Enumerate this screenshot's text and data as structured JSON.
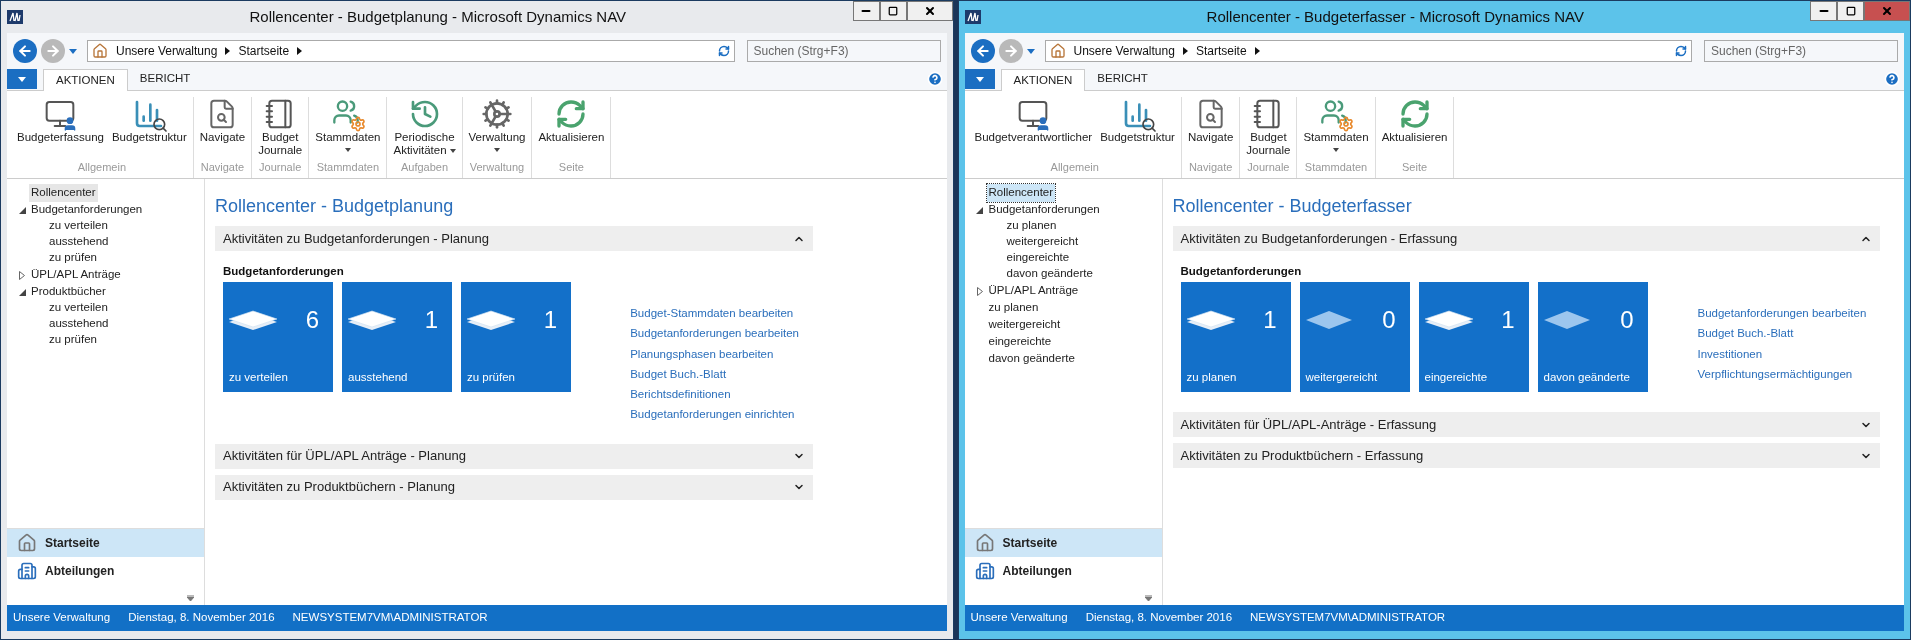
{
  "windows": [
    {
      "title": "Rollencenter - Budgetplanung - Microsoft Dynamics NAV",
      "active": false,
      "breadcrumbs": [
        "Unsere Verwaltung",
        "Startseite"
      ],
      "search": {
        "placeholder": "Suchen (Strg+F3)"
      },
      "tabs": [
        {
          "label": "AKTIONEN",
          "selected": true
        },
        {
          "label": "BERICHT",
          "selected": false
        }
      ],
      "ribbon": [
        {
          "label": "Allgemein",
          "buttons": [
            {
              "kind": "monitor-user",
              "lines": [
                "Budgeterfassung"
              ],
              "dropdown": false
            },
            {
              "kind": "chart-search",
              "lines": [
                "Budgetstruktur"
              ],
              "dropdown": false
            }
          ]
        },
        {
          "label": "Navigate",
          "buttons": [
            {
              "kind": "pages-search",
              "lines": [
                "Navigate"
              ],
              "dropdown": false
            }
          ]
        },
        {
          "label": "Journale",
          "buttons": [
            {
              "kind": "binder",
              "lines": [
                "Budget",
                "Journale"
              ],
              "dropdown": false
            }
          ]
        },
        {
          "label": "Stammdaten",
          "buttons": [
            {
              "kind": "people-gear",
              "lines": [
                "Stammdaten"
              ],
              "dropdown": true
            }
          ]
        },
        {
          "label": "Aufgaben",
          "buttons": [
            {
              "kind": "clock",
              "lines": [
                "Periodische",
                "Aktivitäten"
              ],
              "dropdown": true
            }
          ]
        },
        {
          "label": "Verwaltung",
          "buttons": [
            {
              "kind": "gears",
              "lines": [
                "Verwaltung"
              ],
              "dropdown": true
            }
          ]
        },
        {
          "label": "Seite",
          "buttons": [
            {
              "kind": "refresh",
              "lines": [
                "Aktualisieren"
              ],
              "dropdown": false
            }
          ]
        }
      ],
      "nav": {
        "items": [
          {
            "label": "Rollencenter",
            "selected": true
          },
          {
            "label": "Budgetanforderungen",
            "selected": false,
            "expanded": true,
            "children": [
              {
                "label": "zu verteilen",
                "selected": false
              },
              {
                "label": "ausstehend",
                "selected": false
              },
              {
                "label": "zu prüfen",
                "selected": false
              }
            ]
          },
          {
            "label": "ÜPL/APL Anträge",
            "selected": false,
            "expanded": false
          },
          {
            "label": "Produktbücher",
            "selected": false,
            "expanded": true,
            "children": [
              {
                "label": "zu verteilen",
                "selected": false
              },
              {
                "label": "ausstehend",
                "selected": false
              },
              {
                "label": "zu prüfen",
                "selected": false
              }
            ]
          }
        ],
        "buttons": [
          {
            "kind": "home",
            "label": "Startseite",
            "selected": true
          },
          {
            "kind": "departments",
            "label": "Abteilungen",
            "selected": false
          }
        ]
      },
      "page": {
        "title": "Rollencenter - Budgetplanung",
        "sections": [
          {
            "title": "Aktivitäten zu Budgetanforderungen - Planung",
            "expanded": true,
            "cue_group": "Budgetanforderungen",
            "cues": [
              {
                "count": "6",
                "label": "zu verteilen",
                "faded": false
              },
              {
                "count": "1",
                "label": "ausstehend",
                "faded": false
              },
              {
                "count": "1",
                "label": "zu prüfen",
                "faded": false
              }
            ],
            "links": [
              "Budget-Stammdaten bearbeiten",
              "Budgetanforderungen bearbeiten",
              "Planungsphasen bearbeiten",
              "Budget Buch.-Blatt",
              "Berichtsdefinitionen",
              "Budgetanforderungen einrichten"
            ]
          },
          {
            "title": "Aktivitäten für ÜPL/APL Anträge - Planung",
            "expanded": false
          },
          {
            "title": "Aktivitäten zu Produktbüchern - Planung",
            "expanded": false
          }
        ]
      },
      "status_bar": [
        "Unsere Verwaltung",
        "Dienstag, 8. November 2016",
        "NEWSYSTEM7VM\\ADMINISTRATOR"
      ]
    },
    {
      "title": "Rollencenter - Budgeterfasser - Microsoft Dynamics NAV",
      "active": true,
      "breadcrumbs": [
        "Unsere Verwaltung",
        "Startseite"
      ],
      "search": {
        "placeholder": "Suchen (Strg+F3)"
      },
      "tabs": [
        {
          "label": "AKTIONEN",
          "selected": true
        },
        {
          "label": "BERICHT",
          "selected": false
        }
      ],
      "ribbon": [
        {
          "label": "Allgemein",
          "buttons": [
            {
              "kind": "monitor-user",
              "lines": [
                "Budgetverantwortlicher"
              ],
              "dropdown": false
            },
            {
              "kind": "chart-search",
              "lines": [
                "Budgetstruktur"
              ],
              "dropdown": false
            }
          ]
        },
        {
          "label": "Navigate",
          "buttons": [
            {
              "kind": "pages-search",
              "lines": [
                "Navigate"
              ],
              "dropdown": false
            }
          ]
        },
        {
          "label": "Journale",
          "buttons": [
            {
              "kind": "binder",
              "lines": [
                "Budget",
                "Journale"
              ],
              "dropdown": false
            }
          ]
        },
        {
          "label": "Stammdaten",
          "buttons": [
            {
              "kind": "people-gear",
              "lines": [
                "Stammdaten"
              ],
              "dropdown": true
            }
          ]
        },
        {
          "label": "Seite",
          "buttons": [
            {
              "kind": "refresh",
              "lines": [
                "Aktualisieren"
              ],
              "dropdown": false
            }
          ]
        }
      ],
      "nav": {
        "items": [
          {
            "label": "Rollencenter",
            "selected": true
          },
          {
            "label": "Budgetanforderungen",
            "selected": false,
            "expanded": true,
            "children": [
              {
                "label": "zu planen",
                "selected": false
              },
              {
                "label": "weitergereicht",
                "selected": false
              },
              {
                "label": "eingereichte",
                "selected": false
              },
              {
                "label": "davon geänderte",
                "selected": false
              }
            ]
          },
          {
            "label": "ÜPL/APL Anträge",
            "selected": false,
            "expanded": false
          },
          {
            "label": "zu planen",
            "selected": false
          },
          {
            "label": "weitergereicht",
            "selected": false
          },
          {
            "label": "eingereichte",
            "selected": false
          },
          {
            "label": "davon geänderte",
            "selected": false
          }
        ],
        "buttons": [
          {
            "kind": "home",
            "label": "Startseite",
            "selected": true
          },
          {
            "kind": "departments",
            "label": "Abteilungen",
            "selected": false
          }
        ]
      },
      "page": {
        "title": "Rollencenter - Budgeterfasser",
        "sections": [
          {
            "title": "Aktivitäten zu Budgetanforderungen - Erfassung",
            "expanded": true,
            "cue_group": "Budgetanforderungen",
            "cues": [
              {
                "count": "1",
                "label": "zu planen",
                "faded": false
              },
              {
                "count": "0",
                "label": "weitergereicht",
                "faded": true
              },
              {
                "count": "1",
                "label": "eingereichte",
                "faded": false
              },
              {
                "count": "0",
                "label": "davon geänderte",
                "faded": true
              }
            ],
            "links": [
              "Budgetanforderungen bearbeiten",
              "Budget Buch.-Blatt",
              "Investitionen",
              "Verpflichtungsermächtigungen"
            ]
          },
          {
            "title": "Aktivitäten für ÜPL/APL-Anträge - Erfassung",
            "expanded": false
          },
          {
            "title": "Aktivitäten zu Produktbüchern - Erfassung",
            "expanded": false
          }
        ]
      },
      "status_bar": [
        "Unsere Verwaltung",
        "Dienstag, 8. November 2016",
        "NEWSYSTEM7VM\\ADMINISTRATOR"
      ]
    }
  ]
}
